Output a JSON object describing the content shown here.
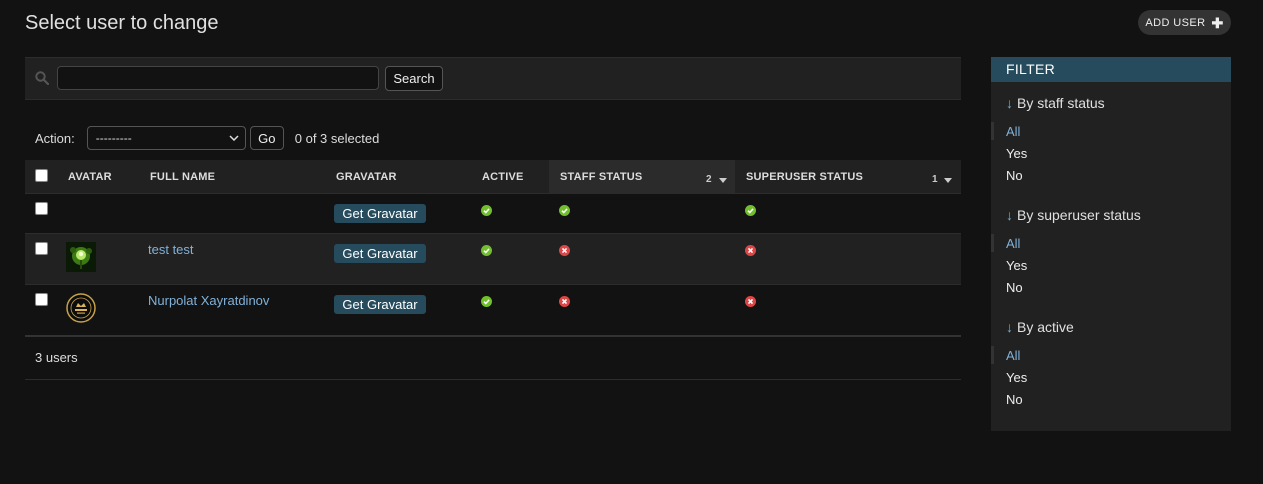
{
  "header": {
    "title": "Select user to change",
    "add_label": "ADD USER"
  },
  "search": {
    "button_label": "Search",
    "value": ""
  },
  "actions": {
    "label": "Action:",
    "selected": "---------",
    "go_label": "Go",
    "selected_count": "0 of 3 selected"
  },
  "table": {
    "columns": [
      "AVATAR",
      "FULL NAME",
      "GRAVATAR",
      "ACTIVE",
      "STAFF STATUS",
      "SUPERUSER STATUS"
    ],
    "sort": {
      "staff_status": "2",
      "superuser_status": "1"
    },
    "rows": [
      {
        "full_name": "",
        "gravatar_label": "Get Gravatar",
        "active": "yes",
        "staff": "yes",
        "superuser": "yes",
        "avatar": "none"
      },
      {
        "full_name": "test test",
        "gravatar_label": "Get Gravatar",
        "active": "yes",
        "staff": "no",
        "superuser": "no",
        "avatar": "green-tree-image"
      },
      {
        "full_name": "Nurpolat Xayratdinov",
        "gravatar_label": "Get Gravatar",
        "active": "yes",
        "staff": "no",
        "superuser": "no",
        "avatar": "gold-logo-image"
      }
    ],
    "count_label": "3 users"
  },
  "filter": {
    "title": "FILTER",
    "groups": [
      {
        "title": "By staff status",
        "options": [
          "All",
          "Yes",
          "No"
        ],
        "selected": "All"
      },
      {
        "title": "By superuser status",
        "options": [
          "All",
          "Yes",
          "No"
        ],
        "selected": "All"
      },
      {
        "title": "By active",
        "options": [
          "All",
          "Yes",
          "No"
        ],
        "selected": "All"
      }
    ]
  },
  "colors": {
    "accent": "#264b5d",
    "link": "#81b1d9",
    "yes": "#70bf2b",
    "no": "#dd4646"
  }
}
